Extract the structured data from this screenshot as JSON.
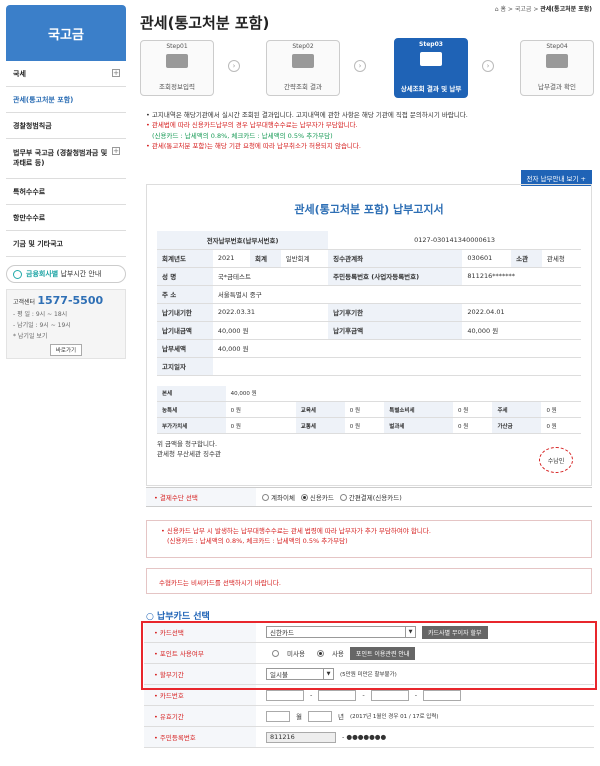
{
  "sidebar": {
    "title": "국고금",
    "items": [
      {
        "label": "국세",
        "plus": "+"
      },
      {
        "label": "관세(통고처분 포함)"
      },
      {
        "label": "경찰청범칙금"
      },
      {
        "label": "법무부 국고금 (경찰청범과금 및 과태료 등)",
        "plus": "+"
      },
      {
        "label": "특허수수료"
      },
      {
        "label": "항만수수료"
      },
      {
        "label": "기금 및 기타국고"
      }
    ],
    "notice_a": "금융회사별",
    "notice_b": "납부시간 안내",
    "call_label": "고객센터",
    "call_number": "1577-5500",
    "call_line1": "- 평   일 : 9시 ~ 18시",
    "call_line2": "- 납기일 : 9시 ~ 19시",
    "call_line3": "* 납기일 보기",
    "call_btn": "바로가기"
  },
  "header": {
    "title": "관세(통고처분 포함)",
    "breadcrumb_home": "⌂ 홈 > 국고금 > ",
    "breadcrumb_current": "관세(통고처분 포함)"
  },
  "steps": [
    {
      "num": "Step01",
      "label": "조회정보입력"
    },
    {
      "num": "Step02",
      "label": "간략조회 결과"
    },
    {
      "num": "Step03",
      "label": "상세조회 결과 및 납부"
    },
    {
      "num": "Step04",
      "label": "납부결과 확인"
    }
  ],
  "info": {
    "line1": "• 고지내역은 해당기관에서 실시간 조회된 결과입니다. 고지내역에 관한 사항은 해당 기관에 직접 문의하시기 바랍니다.",
    "line2": "• 관세법에 따라 신용카드납부의 경우 납부대행수수료는 납부자가 부담합니다.",
    "line3": "(신용카드 : 납세액의 0.8%, 체크카드 : 납세액의 0.5% 추가부담)",
    "line4": "• 관세(통고처분 포함)는 해당 기관 요청에 따라 납부취소가 허용되지 않습니다.",
    "bill_button": "전자 납부안내 보기 +"
  },
  "bill": {
    "title": "관세(통고처분 포함) 납부고지서",
    "epay_label": "전자납부번호(납부서번호)",
    "epay_value": "0127-030141340000613",
    "year_label": "회계년도",
    "year_value": "2021",
    "acct_label": "회계",
    "acct_value": "일반회계",
    "office_label": "징수관계좌",
    "office_value": "030601",
    "dept_label": "소관",
    "dept_value": "관세청",
    "name_label": "성 명",
    "name_value": "국*금테스트",
    "rrn_label": "주민등록번호 (사업자등록번호)",
    "rrn_value": "811216*******",
    "addr_label": "주 소",
    "addr_value": "서울특별시 중구",
    "due_label": "납기내기한",
    "due_value": "2022.03.31",
    "after_label": "납기후기한",
    "after_value": "2022.04.01",
    "amt_label": "납기내금액",
    "amt_value": "40,000 원",
    "after_amt_label": "납기후금액",
    "after_amt_value": "40,000 원",
    "tax_label": "납부세액",
    "tax_value": "40,000 원",
    "notice_label": "고지일자",
    "notice_value": "",
    "tax_rows": [
      [
        "본세",
        "40,000 원",
        "",
        "",
        "",
        "",
        "",
        ""
      ],
      [
        "농특세",
        "0 원",
        "교육세",
        "0 원",
        "특별소비세",
        "0 원",
        "주세",
        "0 원"
      ],
      [
        "부가가치세",
        "0 원",
        "교통세",
        "0 원",
        "벌과세",
        "0 원",
        "가산금",
        "0 원"
      ]
    ],
    "footer1": "위 금액을 청구합니다.",
    "footer2": "관세청 부산세관 징수관",
    "stamp": "수납인"
  },
  "method": {
    "label": "• 결제수단 선택",
    "opt1": "계좌이체",
    "opt2": "신용카드",
    "opt3": "간편결제(신용카드)"
  },
  "warn": {
    "line1": "• 신용카드 납부 시 발생하는 납부대행수수료는 관세 법령에 따라 납부자가 추가 부담하여야 합니다.",
    "line2": "(신용카드 : 납세액의 0.8%, 체크카드 : 납세액의 0.5% 추가부담)",
    "line3": "수협카드는 비씨카드를 선택하시기 바랍니다."
  },
  "card": {
    "section_title": "납부카드 선택",
    "card_label": "• 카드선택",
    "card_value": "신한카드",
    "card_btn": "카드사별 무이자 할부",
    "point_label": "• 포인트 사용여부",
    "point_opt1": "미사용",
    "point_opt2": "사용",
    "point_btn": "포인트 이용관련 안내",
    "inst_label": "• 할부기간",
    "inst_value": "일시불",
    "inst_note": "(5만원 미만은 할부불가)",
    "num_label": "• 카드번호",
    "exp_label": "• 유효기간",
    "exp_month": "월",
    "exp_year": "년",
    "exp_note": "(2017년 1월인 경우 01 / 17로 입력)",
    "rrn_label": "• 주민등록번호",
    "rrn_front": "811216",
    "rrn_back": "- ●●●●●●●"
  }
}
